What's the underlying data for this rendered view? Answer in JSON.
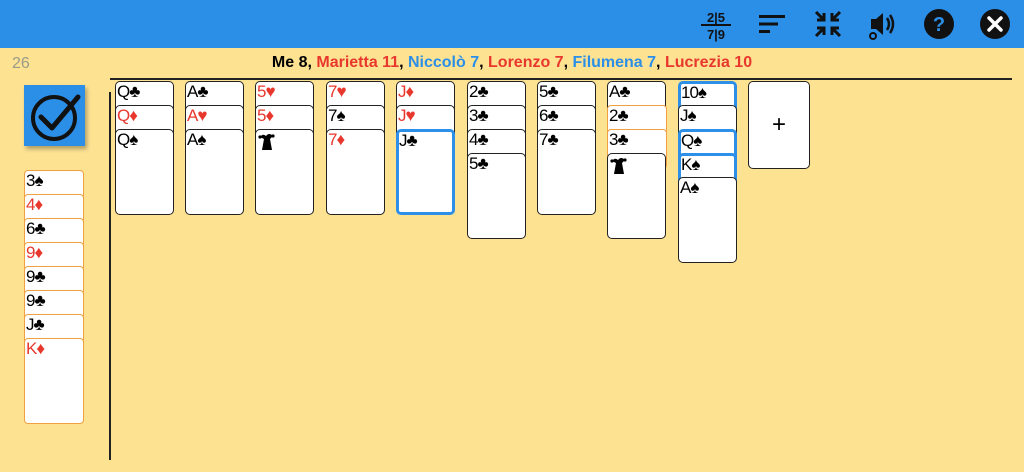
{
  "toolbar": {
    "fraction_top": "2|5",
    "fraction_bottom": "7|9",
    "icons": [
      "fraction-toggle-icon",
      "sort-icon",
      "collapse-icon",
      "sound-icon",
      "help-icon",
      "close-icon"
    ]
  },
  "deck_count": "26",
  "scores": [
    {
      "text": "Me 8",
      "color": "#000000"
    },
    {
      "text": ", ",
      "color": "#000000"
    },
    {
      "text": "Marietta 11",
      "color": "#e8382e"
    },
    {
      "text": ", ",
      "color": "#000000"
    },
    {
      "text": "Niccolò 7",
      "color": "#2b8fe8"
    },
    {
      "text": ", ",
      "color": "#000000"
    },
    {
      "text": "Lorenzo 7",
      "color": "#e8382e"
    },
    {
      "text": ", ",
      "color": "#000000"
    },
    {
      "text": "Filumena 7",
      "color": "#2b8fe8"
    },
    {
      "text": ", ",
      "color": "#000000"
    },
    {
      "text": "Lucrezia 10",
      "color": "#e8382e"
    }
  ],
  "hand": [
    {
      "rank": "3",
      "suit": "♠"
    },
    {
      "rank": "4",
      "suit": "♦"
    },
    {
      "rank": "6",
      "suit": "♣"
    },
    {
      "rank": "9",
      "suit": "♦"
    },
    {
      "rank": "9",
      "suit": "♣"
    },
    {
      "rank": "9",
      "suit": "♣"
    },
    {
      "rank": "J",
      "suit": "♣"
    },
    {
      "rank": "K",
      "suit": "♦"
    }
  ],
  "columns": [
    [
      {
        "rank": "Q",
        "suit": "♣"
      },
      {
        "rank": "Q",
        "suit": "♦"
      },
      {
        "rank": "Q",
        "suit": "♠"
      }
    ],
    [
      {
        "rank": "A",
        "suit": "♣"
      },
      {
        "rank": "A",
        "suit": "♥"
      },
      {
        "rank": "A",
        "suit": "♠"
      }
    ],
    [
      {
        "rank": "5",
        "suit": "♥"
      },
      {
        "rank": "5",
        "suit": "♦"
      },
      {
        "rank": "",
        "suit": "jester"
      }
    ],
    [
      {
        "rank": "7",
        "suit": "♥"
      },
      {
        "rank": "7",
        "suit": "♠"
      },
      {
        "rank": "7",
        "suit": "♦"
      }
    ],
    [
      {
        "rank": "J",
        "suit": "♦"
      },
      {
        "rank": "J",
        "suit": "♥"
      },
      {
        "rank": "J",
        "suit": "♣",
        "selected": true
      }
    ],
    [
      {
        "rank": "2",
        "suit": "♣"
      },
      {
        "rank": "3",
        "suit": "♣"
      },
      {
        "rank": "4",
        "suit": "♣"
      },
      {
        "rank": "5",
        "suit": "♣"
      }
    ],
    [
      {
        "rank": "5",
        "suit": "♣"
      },
      {
        "rank": "6",
        "suit": "♣"
      },
      {
        "rank": "7",
        "suit": "♣"
      }
    ],
    [
      {
        "rank": "A",
        "suit": "♣"
      },
      {
        "rank": "2",
        "suit": "♣",
        "hand": true
      },
      {
        "rank": "3",
        "suit": "♣",
        "hand": true
      },
      {
        "rank": "",
        "suit": "jester"
      }
    ],
    [
      {
        "rank": "10",
        "suit": "♠",
        "selected": true
      },
      {
        "rank": "J",
        "suit": "♠"
      },
      {
        "rank": "Q",
        "suit": "♠",
        "selected": true
      },
      {
        "rank": "K",
        "suit": "♠",
        "selected": true
      },
      {
        "rank": "A",
        "suit": "♠"
      }
    ]
  ],
  "add_label": "+"
}
